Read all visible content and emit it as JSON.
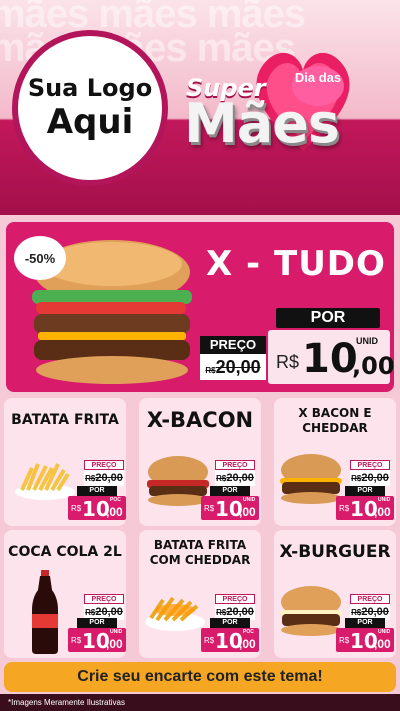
{
  "header": {
    "bg_words": [
      "mães mães mães",
      "mãesmães mães"
    ],
    "logo_line1": "Sua Logo",
    "logo_line2": "Aqui",
    "brand_super": "Super",
    "brand_dia": "Dia das",
    "brand_maes": "Mães"
  },
  "featured": {
    "title": "X - TUDO",
    "discount_badge": "-50%",
    "preco_label": "PREÇO",
    "old_currency": "R$",
    "old_price": "20,00",
    "por_label": "POR",
    "currency": "R$",
    "price_int": "10",
    "price_cents": ",00",
    "unit": "UNID"
  },
  "products": [
    {
      "name": "BATATA FRITA",
      "unit": "POC"
    },
    {
      "name": "X-BACON",
      "unit": "UNID"
    },
    {
      "name": "X BACON E CHEDDAR",
      "unit": "UNID"
    },
    {
      "name": "COCA COLA 2L",
      "unit": "UNID"
    },
    {
      "name": "BATATA FRITA COM CHEDDAR",
      "unit": "POC"
    },
    {
      "name": "X-BURGUER",
      "unit": "UNID"
    }
  ],
  "price_common": {
    "preco_label": "PREÇO",
    "old_currency": "R$",
    "old_price": "20,00",
    "por_label": "POR",
    "currency": "R$",
    "price_int": "10",
    "price_cents": ",00"
  },
  "cta": "Crie seu encarte com este tema!",
  "disclaimer": "*Imagens Meramente Ilustrativas",
  "colors": {
    "accent": "#d81b6b",
    "cta": "#f5a623",
    "card": "#fde4ec"
  }
}
